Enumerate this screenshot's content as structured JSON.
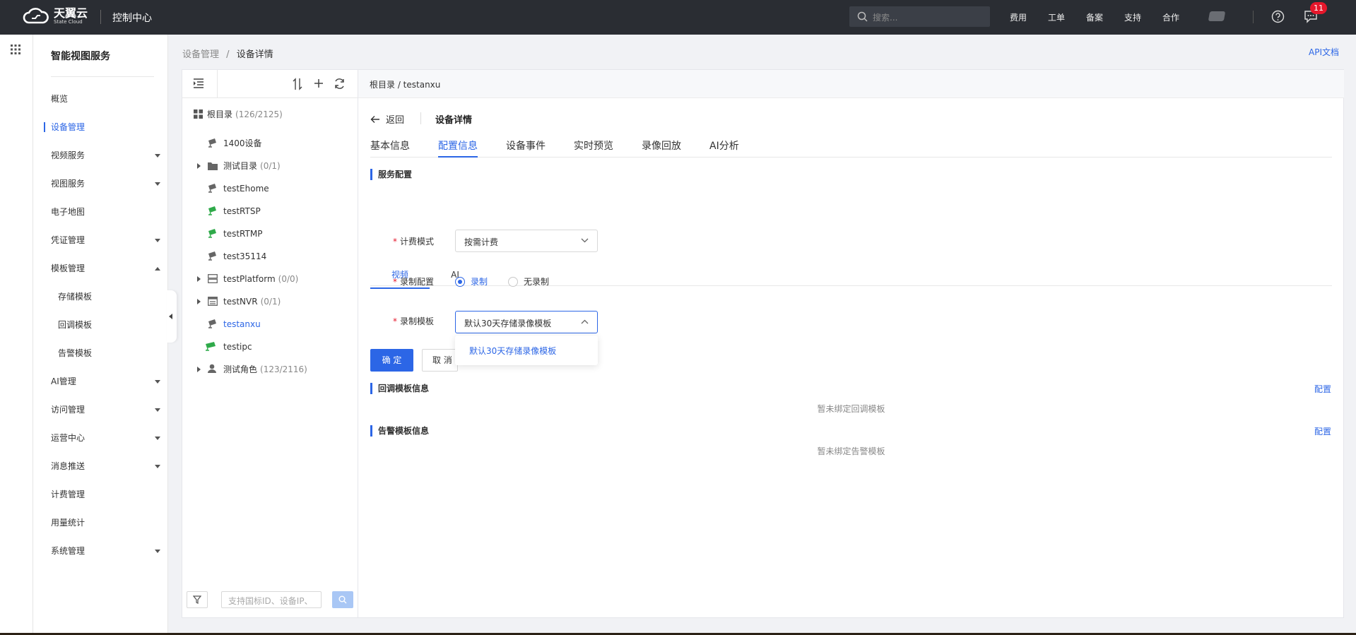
{
  "topbar": {
    "brand_cn": "天翼云",
    "brand_en": "State Cloud",
    "console": "控制中心",
    "search_placeholder": "搜索...",
    "nav": [
      "费用",
      "工单",
      "备案",
      "支持",
      "合作"
    ],
    "notifications": "11"
  },
  "sidebar": {
    "title": "智能视图服务",
    "items": [
      {
        "label": "概览"
      },
      {
        "label": "设备管理"
      },
      {
        "label": "视频服务"
      },
      {
        "label": "视图服务"
      },
      {
        "label": "电子地图"
      },
      {
        "label": "凭证管理"
      },
      {
        "label": "模板管理"
      },
      {
        "label": "存储模板"
      },
      {
        "label": "回调模板"
      },
      {
        "label": "告警模板"
      },
      {
        "label": "AI管理"
      },
      {
        "label": "访问管理"
      },
      {
        "label": "运营中心"
      },
      {
        "label": "消息推送"
      },
      {
        "label": "计费管理"
      },
      {
        "label": "用量统计"
      },
      {
        "label": "系统管理"
      }
    ]
  },
  "breadcrumb": {
    "parent": "设备管理",
    "sep": "/",
    "current": "设备详情"
  },
  "api_doc": "API文档",
  "tree": {
    "root": {
      "label": "根目录",
      "count": "(126/2125)"
    },
    "nodes": [
      {
        "label": "1400设备",
        "count": ""
      },
      {
        "label": "测试目录",
        "count": "(0/1)"
      },
      {
        "label": "testEhome",
        "count": ""
      },
      {
        "label": "testRTSP",
        "count": ""
      },
      {
        "label": "testRTMP",
        "count": ""
      },
      {
        "label": "test35114",
        "count": ""
      },
      {
        "label": "testPlatform",
        "count": "(0/0)"
      },
      {
        "label": "testNVR",
        "count": "(0/1)"
      },
      {
        "label": "testanxu",
        "count": ""
      },
      {
        "label": "testipc",
        "count": ""
      },
      {
        "label": "测试角色",
        "count": "(123/2116)"
      }
    ],
    "search_placeholder": "支持国标ID、设备IP、"
  },
  "detail": {
    "path": "根目录 / testanxu",
    "back": "返回",
    "title": "设备详情",
    "tabs": [
      "基本信息",
      "配置信息",
      "设备事件",
      "实时预览",
      "录像回放",
      "AI分析"
    ],
    "service_config": "服务配置",
    "sub_tabs": [
      "视频",
      "AI"
    ],
    "form": {
      "billing_label": "计费模式",
      "billing_value": "按需计费",
      "record_label": "录制配置",
      "record_on": "录制",
      "record_off": "无录制",
      "template_label": "录制模板",
      "template_value": "默认30天存储录像模板",
      "dropdown_option": "默认30天存储录像模板",
      "ok": "确 定",
      "cancel": "取 消"
    },
    "callback_section": "回调模板信息",
    "callback_empty": "暂未绑定回调模板",
    "alarm_section": "告警模板信息",
    "alarm_empty": "暂未绑定告警模板",
    "config_link": "配置"
  }
}
